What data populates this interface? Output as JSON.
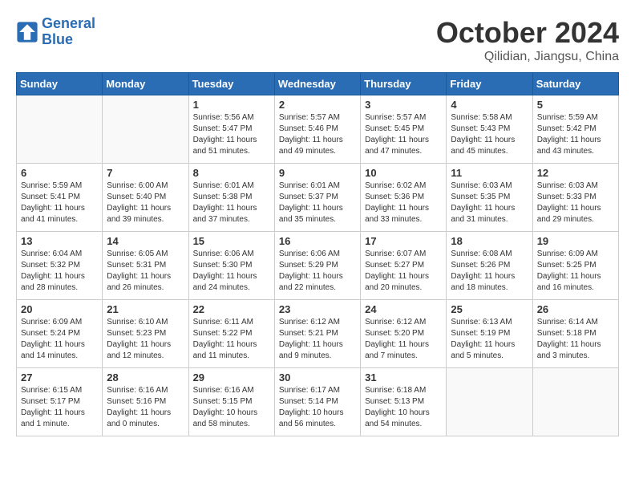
{
  "header": {
    "logo_line1": "General",
    "logo_line2": "Blue",
    "month": "October 2024",
    "location": "Qilidian, Jiangsu, China"
  },
  "weekdays": [
    "Sunday",
    "Monday",
    "Tuesday",
    "Wednesday",
    "Thursday",
    "Friday",
    "Saturday"
  ],
  "weeks": [
    [
      {
        "day": "",
        "info": ""
      },
      {
        "day": "",
        "info": ""
      },
      {
        "day": "1",
        "info": "Sunrise: 5:56 AM\nSunset: 5:47 PM\nDaylight: 11 hours\nand 51 minutes."
      },
      {
        "day": "2",
        "info": "Sunrise: 5:57 AM\nSunset: 5:46 PM\nDaylight: 11 hours\nand 49 minutes."
      },
      {
        "day": "3",
        "info": "Sunrise: 5:57 AM\nSunset: 5:45 PM\nDaylight: 11 hours\nand 47 minutes."
      },
      {
        "day": "4",
        "info": "Sunrise: 5:58 AM\nSunset: 5:43 PM\nDaylight: 11 hours\nand 45 minutes."
      },
      {
        "day": "5",
        "info": "Sunrise: 5:59 AM\nSunset: 5:42 PM\nDaylight: 11 hours\nand 43 minutes."
      }
    ],
    [
      {
        "day": "6",
        "info": "Sunrise: 5:59 AM\nSunset: 5:41 PM\nDaylight: 11 hours\nand 41 minutes."
      },
      {
        "day": "7",
        "info": "Sunrise: 6:00 AM\nSunset: 5:40 PM\nDaylight: 11 hours\nand 39 minutes."
      },
      {
        "day": "8",
        "info": "Sunrise: 6:01 AM\nSunset: 5:38 PM\nDaylight: 11 hours\nand 37 minutes."
      },
      {
        "day": "9",
        "info": "Sunrise: 6:01 AM\nSunset: 5:37 PM\nDaylight: 11 hours\nand 35 minutes."
      },
      {
        "day": "10",
        "info": "Sunrise: 6:02 AM\nSunset: 5:36 PM\nDaylight: 11 hours\nand 33 minutes."
      },
      {
        "day": "11",
        "info": "Sunrise: 6:03 AM\nSunset: 5:35 PM\nDaylight: 11 hours\nand 31 minutes."
      },
      {
        "day": "12",
        "info": "Sunrise: 6:03 AM\nSunset: 5:33 PM\nDaylight: 11 hours\nand 29 minutes."
      }
    ],
    [
      {
        "day": "13",
        "info": "Sunrise: 6:04 AM\nSunset: 5:32 PM\nDaylight: 11 hours\nand 28 minutes."
      },
      {
        "day": "14",
        "info": "Sunrise: 6:05 AM\nSunset: 5:31 PM\nDaylight: 11 hours\nand 26 minutes."
      },
      {
        "day": "15",
        "info": "Sunrise: 6:06 AM\nSunset: 5:30 PM\nDaylight: 11 hours\nand 24 minutes."
      },
      {
        "day": "16",
        "info": "Sunrise: 6:06 AM\nSunset: 5:29 PM\nDaylight: 11 hours\nand 22 minutes."
      },
      {
        "day": "17",
        "info": "Sunrise: 6:07 AM\nSunset: 5:27 PM\nDaylight: 11 hours\nand 20 minutes."
      },
      {
        "day": "18",
        "info": "Sunrise: 6:08 AM\nSunset: 5:26 PM\nDaylight: 11 hours\nand 18 minutes."
      },
      {
        "day": "19",
        "info": "Sunrise: 6:09 AM\nSunset: 5:25 PM\nDaylight: 11 hours\nand 16 minutes."
      }
    ],
    [
      {
        "day": "20",
        "info": "Sunrise: 6:09 AM\nSunset: 5:24 PM\nDaylight: 11 hours\nand 14 minutes."
      },
      {
        "day": "21",
        "info": "Sunrise: 6:10 AM\nSunset: 5:23 PM\nDaylight: 11 hours\nand 12 minutes."
      },
      {
        "day": "22",
        "info": "Sunrise: 6:11 AM\nSunset: 5:22 PM\nDaylight: 11 hours\nand 11 minutes."
      },
      {
        "day": "23",
        "info": "Sunrise: 6:12 AM\nSunset: 5:21 PM\nDaylight: 11 hours\nand 9 minutes."
      },
      {
        "day": "24",
        "info": "Sunrise: 6:12 AM\nSunset: 5:20 PM\nDaylight: 11 hours\nand 7 minutes."
      },
      {
        "day": "25",
        "info": "Sunrise: 6:13 AM\nSunset: 5:19 PM\nDaylight: 11 hours\nand 5 minutes."
      },
      {
        "day": "26",
        "info": "Sunrise: 6:14 AM\nSunset: 5:18 PM\nDaylight: 11 hours\nand 3 minutes."
      }
    ],
    [
      {
        "day": "27",
        "info": "Sunrise: 6:15 AM\nSunset: 5:17 PM\nDaylight: 11 hours\nand 1 minute."
      },
      {
        "day": "28",
        "info": "Sunrise: 6:16 AM\nSunset: 5:16 PM\nDaylight: 11 hours\nand 0 minutes."
      },
      {
        "day": "29",
        "info": "Sunrise: 6:16 AM\nSunset: 5:15 PM\nDaylight: 10 hours\nand 58 minutes."
      },
      {
        "day": "30",
        "info": "Sunrise: 6:17 AM\nSunset: 5:14 PM\nDaylight: 10 hours\nand 56 minutes."
      },
      {
        "day": "31",
        "info": "Sunrise: 6:18 AM\nSunset: 5:13 PM\nDaylight: 10 hours\nand 54 minutes."
      },
      {
        "day": "",
        "info": ""
      },
      {
        "day": "",
        "info": ""
      }
    ]
  ]
}
